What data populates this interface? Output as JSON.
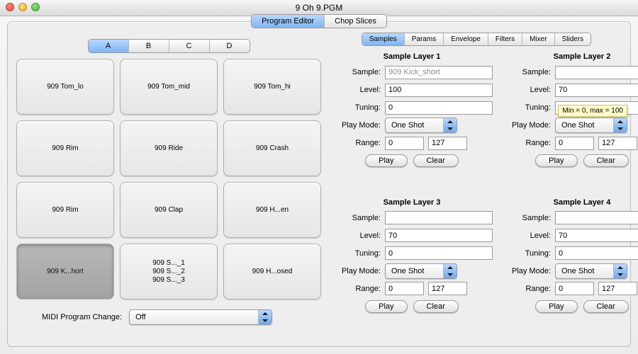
{
  "title": "9 Oh 9.PGM",
  "mainTabs": {
    "program": "Program Editor",
    "chop": "Chop Slices"
  },
  "banks": [
    "A",
    "B",
    "C",
    "D"
  ],
  "pads": [
    {
      "lines": [
        "909 Tom_lo"
      ],
      "sel": false
    },
    {
      "lines": [
        "909 Tom_mid"
      ],
      "sel": false
    },
    {
      "lines": [
        "909 Tom_hi"
      ],
      "sel": false
    },
    {
      "lines": [
        "909 Rim"
      ],
      "sel": false
    },
    {
      "lines": [
        "909 Ride"
      ],
      "sel": false
    },
    {
      "lines": [
        "909 Crash"
      ],
      "sel": false
    },
    {
      "lines": [
        "909 Rim"
      ],
      "sel": false
    },
    {
      "lines": [
        "909 Clap"
      ],
      "sel": false
    },
    {
      "lines": [
        "909 H...en"
      ],
      "sel": false
    },
    {
      "lines": [
        "909 K...hort"
      ],
      "sel": true
    },
    {
      "lines": [
        "909 S..._1",
        "909 S..._2",
        "909 S..._3"
      ],
      "sel": false
    },
    {
      "lines": [
        "909 H...osed"
      ],
      "sel": false
    }
  ],
  "midi": {
    "label": "MIDI Program Change:",
    "value": "Off"
  },
  "rightTabs": [
    "Samples",
    "Params",
    "Envelope",
    "Filters",
    "Mixer",
    "Sliders"
  ],
  "layerLabels": {
    "sample": "Sample:",
    "level": "Level:",
    "tuning": "Tuning:",
    "playmode": "Play Mode:",
    "range": "Range:",
    "play": "Play",
    "clear": "Clear"
  },
  "layers": [
    {
      "title": "Sample Layer 1",
      "sample": "909 Kick_short",
      "sampleGhost": true,
      "level": "100",
      "tuning": "0",
      "playmode": "One Shot",
      "range": [
        "0",
        "127"
      ]
    },
    {
      "title": "Sample Layer 2",
      "sample": "",
      "sampleGhost": false,
      "level": "70",
      "tuning": "",
      "playmode": "One Shot",
      "range": [
        "0",
        "127"
      ]
    },
    {
      "title": "Sample Layer 3",
      "sample": "",
      "sampleGhost": false,
      "level": "70",
      "tuning": "0",
      "playmode": "One Shot",
      "range": [
        "0",
        "127"
      ]
    },
    {
      "title": "Sample Layer 4",
      "sample": "",
      "sampleGhost": false,
      "level": "70",
      "tuning": "0",
      "playmode": "One Shot",
      "range": [
        "0",
        "127"
      ]
    }
  ],
  "tooltip": "Min = 0, max = 100"
}
